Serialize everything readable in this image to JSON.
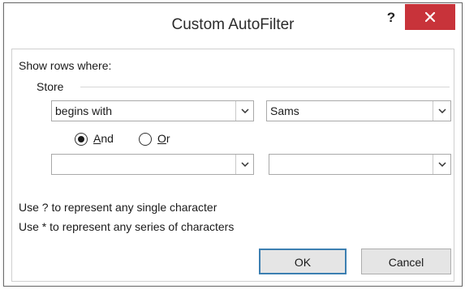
{
  "window": {
    "title": "Custom AutoFilter",
    "help_label": "?",
    "close_label": "×"
  },
  "filter": {
    "heading": "Show rows where:",
    "field_name": "Store",
    "condition1": {
      "operator": "begins with",
      "value": "Sams"
    },
    "logic": {
      "and_prefix": "",
      "and_hotkey": "A",
      "and_rest": "nd",
      "or_hotkey": "O",
      "or_rest": "r",
      "selected": "And"
    },
    "condition2": {
      "operator": "",
      "value": ""
    }
  },
  "hints": {
    "single": "Use ? to represent any single character",
    "series": "Use * to represent any series of characters"
  },
  "buttons": {
    "ok": "OK",
    "cancel": "Cancel"
  },
  "colors": {
    "close_bg": "#c8333a",
    "default_button_border": "#3c7fb1"
  }
}
